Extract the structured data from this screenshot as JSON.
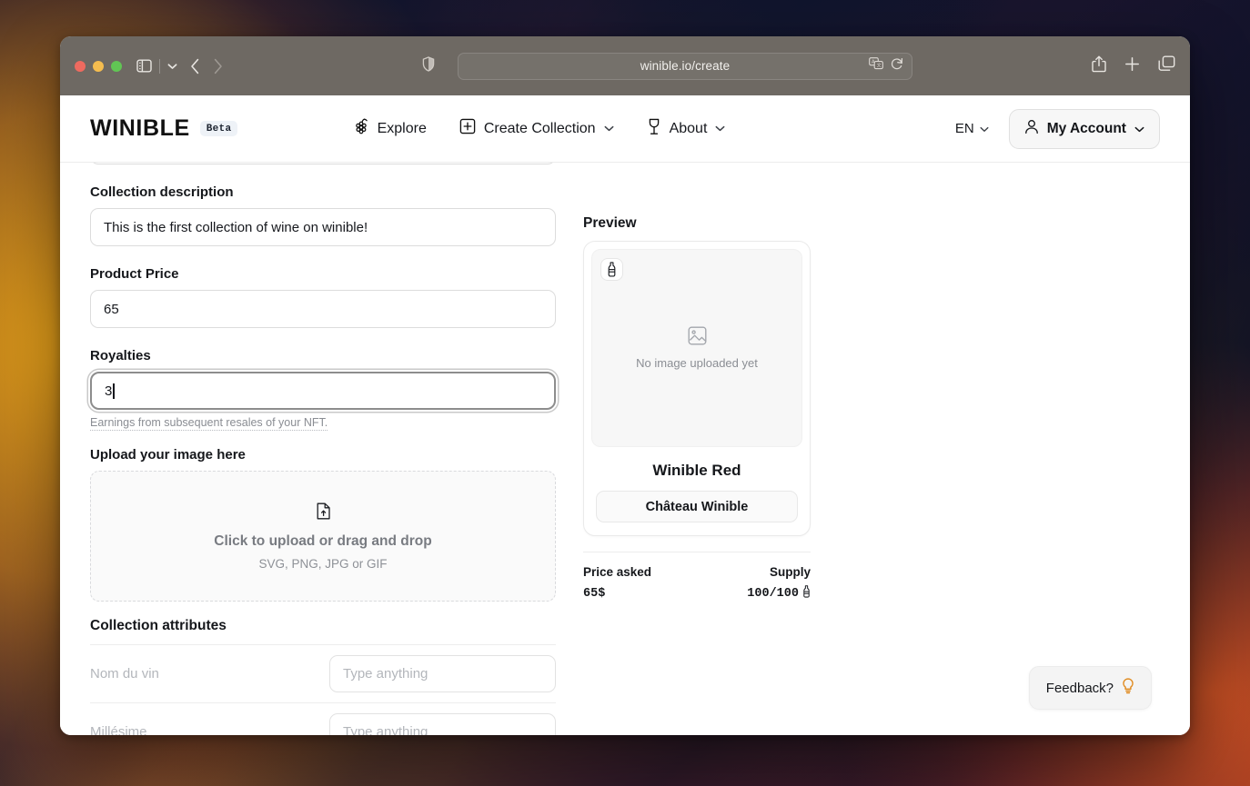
{
  "browser": {
    "url": "winible.io/create",
    "icons": {
      "shield": "shield-icon",
      "sidebar": "sidebar-toggle-icon",
      "sidebar_chevron": "chevron-down-icon",
      "back": "back-arrow-icon",
      "forward": "forward-arrow-icon",
      "translate": "translate-icon",
      "reload": "reload-icon",
      "share": "share-icon",
      "new_tab": "plus-icon",
      "tabs": "tab-overview-icon"
    }
  },
  "header": {
    "logo": "WINIBLE",
    "badge": "Beta",
    "nav": [
      {
        "label": "Explore",
        "icon": "grape-icon",
        "chevron": false
      },
      {
        "label": "Create Collection",
        "icon": "plus-square-icon",
        "chevron": true
      },
      {
        "label": "About",
        "icon": "wine-glass-icon",
        "chevron": true
      }
    ],
    "language": "EN",
    "account_label": "My Account"
  },
  "form": {
    "supply_value_clipped": "100",
    "description_label": "Collection description",
    "description_value": "This is the first collection of wine on winible!",
    "price_label": "Product Price",
    "price_value": "65",
    "royalties_label": "Royalties",
    "royalties_value": "3",
    "royalties_help": "Earnings from subsequent resales of your NFT.",
    "upload_label": "Upload your image here",
    "upload_cta": "Click to upload or drag and drop",
    "upload_formats": "SVG, PNG, JPG or GIF",
    "attributes_title": "Collection attributes",
    "attributes": [
      {
        "name": "Nom du vin",
        "placeholder": "Type anything",
        "value": ""
      },
      {
        "name": "Millésime",
        "placeholder": "Type anything",
        "value": ""
      }
    ]
  },
  "preview": {
    "label": "Preview",
    "badge_icon": "wine-bottle-icon",
    "empty_image_icon": "image-placeholder-icon",
    "empty_image_text": "No image uploaded yet",
    "product_name": "Winible Red",
    "chateau_label": "Château Winible",
    "price_head": "Price asked",
    "price_value": "65$",
    "supply_head": "Supply",
    "supply_value": "100/100",
    "supply_icon": "wine-bottle-icon"
  },
  "feedback": {
    "label": "Feedback?",
    "icon": "lightbulb-icon",
    "icon_color": "#e08a1e"
  },
  "colors": {
    "toolbar": "#6e6963",
    "page_bg": "#ffffff",
    "text": "#15171b",
    "muted": "#8a8d93",
    "border": "#e3e3e3",
    "badge_bg": "#eef2f7"
  }
}
